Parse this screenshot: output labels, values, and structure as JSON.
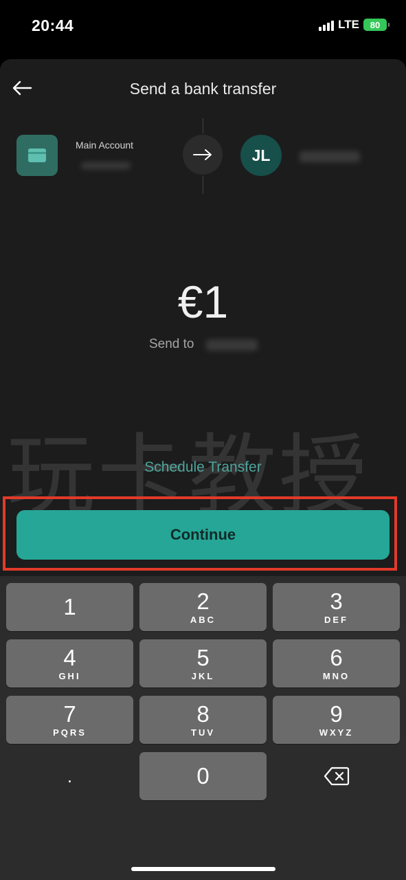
{
  "status_bar": {
    "time": "20:44",
    "network": "LTE",
    "battery": "80"
  },
  "header": {
    "title": "Send a bank transfer",
    "back_icon": "arrow-left-icon"
  },
  "transfer": {
    "from_label": "Main Account",
    "to_initials": "JL"
  },
  "amount": {
    "value": "€1",
    "send_to_label": "Send to"
  },
  "watermark": "玩卡教授",
  "actions": {
    "schedule_label": "Schedule Transfer",
    "continue_label": "Continue"
  },
  "keypad": {
    "keys": [
      {
        "num": "1",
        "letters": ""
      },
      {
        "num": "2",
        "letters": "ABC"
      },
      {
        "num": "3",
        "letters": "DEF"
      },
      {
        "num": "4",
        "letters": "GHI"
      },
      {
        "num": "5",
        "letters": "JKL"
      },
      {
        "num": "6",
        "letters": "MNO"
      },
      {
        "num": "7",
        "letters": "PQRS"
      },
      {
        "num": "8",
        "letters": "TUV"
      },
      {
        "num": "9",
        "letters": "WXYZ"
      },
      {
        "num": ".",
        "letters": ""
      },
      {
        "num": "0",
        "letters": ""
      }
    ],
    "delete_icon": "backspace-icon"
  },
  "colors": {
    "accent": "#26a696",
    "link": "#4ea59c",
    "highlight": "#e23a2a",
    "sheet": "#1c1c1c"
  }
}
